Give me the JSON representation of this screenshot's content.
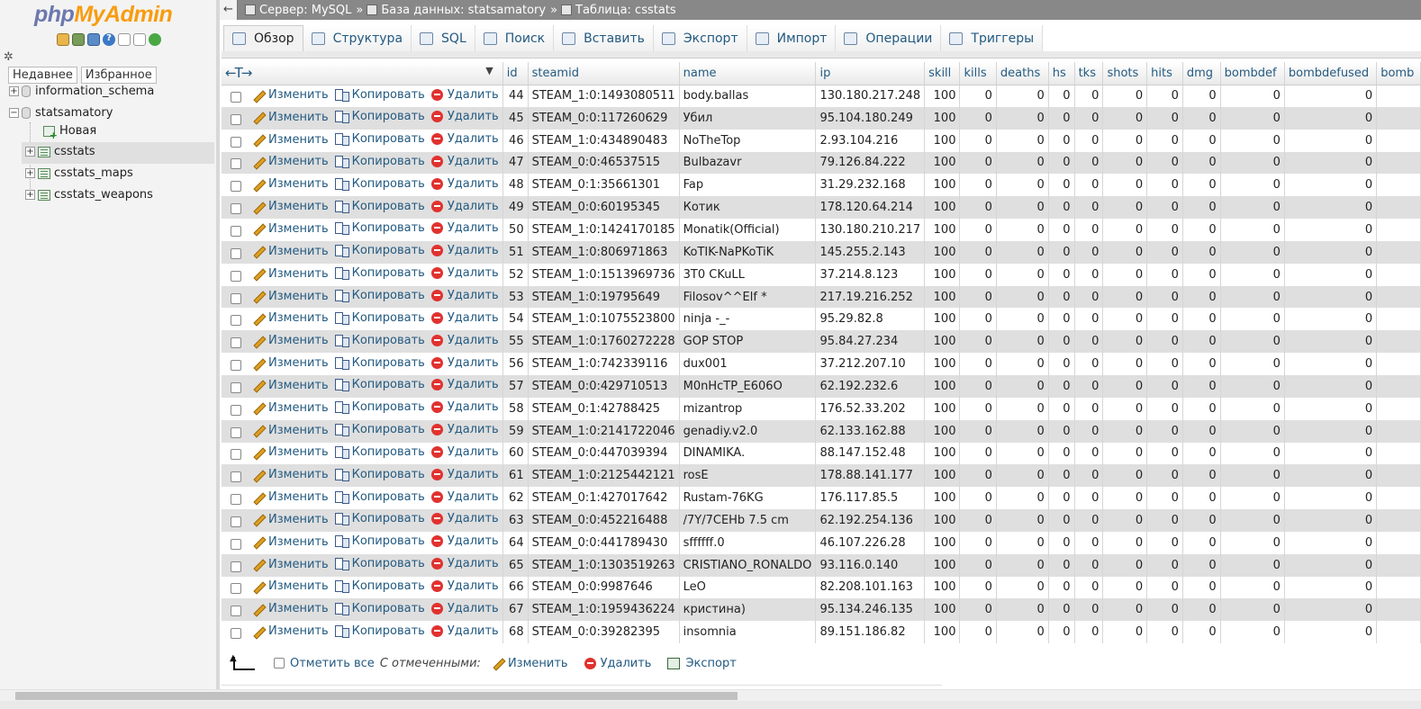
{
  "logo": {
    "php": "php",
    "admin": "MyAdmin"
  },
  "nav_tabs": [
    "Недавнее",
    "Избранное"
  ],
  "tree": {
    "db1": "information_schema",
    "db2": "statsamatory",
    "new_label": "Новая",
    "tables": [
      "csstats",
      "csstats_maps",
      "csstats_weapons"
    ]
  },
  "breadcrumb": {
    "server": "Сервер: MySQL",
    "database": "База данных: statsamatory",
    "table": "Таблица: csstats",
    "separator": "»"
  },
  "tabs": [
    "Обзор",
    "Структура",
    "SQL",
    "Поиск",
    "Вставить",
    "Экспорт",
    "Импорт",
    "Операции",
    "Триггеры"
  ],
  "columns": [
    "id",
    "steamid",
    "name",
    "ip",
    "skill",
    "kills",
    "deaths",
    "hs",
    "tks",
    "shots",
    "hits",
    "dmg",
    "bombdef",
    "bombdefused",
    "bomb"
  ],
  "actions": {
    "edit": "Изменить",
    "copy": "Копировать",
    "delete": "Удалить"
  },
  "arrows_label": "←T→",
  "rows": [
    {
      "id": "44",
      "steamid": "STEAM_1:0:1493080511",
      "name": "body.ballas",
      "ip": "130.180.217.248"
    },
    {
      "id": "45",
      "steamid": "STEAM_0:0:117260629",
      "name": "Убил",
      "ip": "95.104.180.249"
    },
    {
      "id": "46",
      "steamid": "STEAM_1:0:434890483",
      "name": "NoTheTop",
      "ip": "2.93.104.216"
    },
    {
      "id": "47",
      "steamid": "STEAM_0:0:46537515",
      "name": "Bulbazavr",
      "ip": "79.126.84.222"
    },
    {
      "id": "48",
      "steamid": "STEAM_0:1:35661301",
      "name": "Fap",
      "ip": "31.29.232.168"
    },
    {
      "id": "49",
      "steamid": "STEAM_0:0:60195345",
      "name": "Котик",
      "ip": "178.120.64.214"
    },
    {
      "id": "50",
      "steamid": "STEAM_1:0:1424170185",
      "name": "Monatik(Official)",
      "ip": "130.180.210.217"
    },
    {
      "id": "51",
      "steamid": "STEAM_1:0:806971863",
      "name": "KoTIK-NaPKoTiK",
      "ip": "145.255.2.143"
    },
    {
      "id": "52",
      "steamid": "STEAM_1:0:1513969736",
      "name": "3T0 CKuLL",
      "ip": "37.214.8.123"
    },
    {
      "id": "53",
      "steamid": "STEAM_1:0:19795649",
      "name": "Filosov^^Elf *",
      "ip": "217.19.216.252"
    },
    {
      "id": "54",
      "steamid": "STEAM_1:0:1075523800",
      "name": "ninja -_-",
      "ip": "95.29.82.8"
    },
    {
      "id": "55",
      "steamid": "STEAM_1:0:1760272228",
      "name": "GOP STOP",
      "ip": "95.84.27.234"
    },
    {
      "id": "56",
      "steamid": "STEAM_1:0:742339116",
      "name": "dux001",
      "ip": "37.212.207.10"
    },
    {
      "id": "57",
      "steamid": "STEAM_0:0:429710513",
      "name": "M0nHcTP_E606O",
      "ip": "62.192.232.6"
    },
    {
      "id": "58",
      "steamid": "STEAM_0:1:42788425",
      "name": "mizantrop",
      "ip": "176.52.33.202"
    },
    {
      "id": "59",
      "steamid": "STEAM_1:0:2141722046",
      "name": "genadiy.v2.0",
      "ip": "62.133.162.88"
    },
    {
      "id": "60",
      "steamid": "STEAM_0:0:447039394",
      "name": "DINAMIKA.",
      "ip": "88.147.152.48"
    },
    {
      "id": "61",
      "steamid": "STEAM_1:0:2125442121",
      "name": "rosE",
      "ip": "178.88.141.177"
    },
    {
      "id": "62",
      "steamid": "STEAM_0:1:427017642",
      "name": "Rustam-76KG",
      "ip": "176.117.85.5"
    },
    {
      "id": "63",
      "steamid": "STEAM_0:0:452216488",
      "name": "/7Y/7CEHb 7.5 cm",
      "ip": "62.192.254.136"
    },
    {
      "id": "64",
      "steamid": "STEAM_0:0:441789430",
      "name": "sffffff.0",
      "ip": "46.107.226.28"
    },
    {
      "id": "65",
      "steamid": "STEAM_1:0:1303519263",
      "name": "CRISTIANO_RONALDO",
      "ip": "93.116.0.140"
    },
    {
      "id": "66",
      "steamid": "STEAM_0:0:9987646",
      "name": "LeO",
      "ip": "82.208.101.163"
    },
    {
      "id": "67",
      "steamid": "STEAM_1:0:1959436224",
      "name": "кристина)",
      "ip": "95.134.246.135"
    },
    {
      "id": "68",
      "steamid": "STEAM_0:0:39282395",
      "name": "insomnia",
      "ip": "89.151.186.82"
    }
  ],
  "row_defaults": {
    "skill": "100",
    "kills": "0",
    "deaths": "0",
    "hs": "0",
    "tks": "0",
    "shots": "0",
    "hits": "0",
    "dmg": "0",
    "bombdef": "0",
    "bombdefused": "0"
  },
  "bottom": {
    "check_all": "Отметить все",
    "with_selected": "С отмеченными:",
    "edit": "Изменить",
    "delete": "Удалить",
    "export": "Экспорт"
  }
}
